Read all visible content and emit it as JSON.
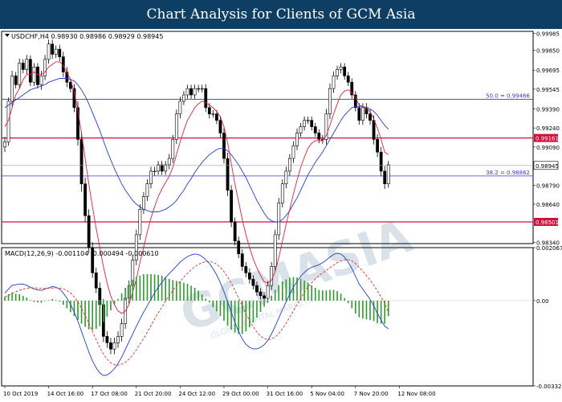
{
  "banner": {
    "title": "Chart Analysis for Clients of GCM Asia"
  },
  "watermark": {
    "text": "GCMASIA",
    "subtext": "GLOBAL CAPITAL MARKETS"
  },
  "chart_data": [
    {
      "type": "candlestick",
      "header": "USDCHF,H4  0.98930 0.98986 0.98929 0.98945",
      "ylim": [
        0.9833,
        1.0
      ],
      "y_ticks": [
        "0.99985",
        "0.99850",
        "0.99695",
        "0.99545",
        "0.99390",
        "0.99240",
        "0.99090",
        "0.98945",
        "0.98790",
        "0.98640",
        "0.98490",
        "0.98340"
      ],
      "y_tick_values": [
        0.99985,
        0.9985,
        0.99695,
        0.99545,
        0.9939,
        0.9924,
        0.9909,
        0.98945,
        0.9879,
        0.9864,
        0.9849,
        0.9834
      ],
      "x_ticks": [
        "10 Oct 2019",
        "14 Oct 16:00",
        "17 Oct 08:00",
        "21 Oct 20:00",
        "24 Oct 12:00",
        "29 Oct 00:00",
        "31 Oct 16:00",
        "5 Nov 04:00",
        "7 Nov 20:00",
        "12 Nov 08:00"
      ],
      "x_tick_index": [
        0,
        12,
        24,
        36,
        48,
        60,
        72,
        84,
        96,
        108
      ],
      "num_bars": 120,
      "current_price": {
        "label": "0.98945",
        "value": 0.98945
      },
      "levels": [
        {
          "kind": "fib",
          "label": "50.0 = 0.99466",
          "value": 0.99466,
          "color": "#3a3ac8"
        },
        {
          "kind": "fib",
          "label": "38.2 = 0.98862",
          "value": 0.98862,
          "color": "#3a3ac8"
        },
        {
          "kind": "sr",
          "label": "0.99161",
          "value": 0.99161,
          "color": "#d0103a"
        },
        {
          "kind": "sr",
          "label": "0.98501",
          "value": 0.98501,
          "color": "#d0103a"
        }
      ],
      "closes": [
        0.9913,
        0.9945,
        0.9965,
        0.9958,
        0.9975,
        0.997,
        0.9978,
        0.996,
        0.9972,
        0.9958,
        0.9965,
        0.9978,
        0.999,
        0.9982,
        0.9986,
        0.998,
        0.9968,
        0.996,
        0.9955,
        0.994,
        0.9915,
        0.988,
        0.9855,
        0.983,
        0.981,
        0.9798,
        0.9785,
        0.976,
        0.9755,
        0.975,
        0.9755,
        0.976,
        0.977,
        0.979,
        0.98,
        0.982,
        0.984,
        0.986,
        0.987,
        0.988,
        0.989,
        0.989,
        0.9895,
        0.989,
        0.9895,
        0.99,
        0.9915,
        0.9935,
        0.9945,
        0.995,
        0.9955,
        0.995,
        0.9955,
        0.9955,
        0.9955,
        0.994,
        0.9935,
        0.9935,
        0.993,
        0.992,
        0.99,
        0.9875,
        0.985,
        0.9835,
        0.9825,
        0.9815,
        0.981,
        0.9805,
        0.98,
        0.9795,
        0.9792,
        0.979,
        0.98,
        0.9815,
        0.984,
        0.9865,
        0.988,
        0.989,
        0.99,
        0.991,
        0.992,
        0.9925,
        0.993,
        0.993,
        0.9925,
        0.992,
        0.9915,
        0.9915,
        0.9935,
        0.9955,
        0.9965,
        0.997,
        0.9972,
        0.9965,
        0.996,
        0.995,
        0.994,
        0.993,
        0.994,
        0.9935,
        0.993,
        0.9915,
        0.9905,
        0.989,
        0.988,
        0.9895
      ],
      "volatility": [
        0.0008,
        0.0006,
        0.0008,
        0.0006,
        0.0007,
        0.0006,
        0.0007,
        0.0006,
        0.0006,
        0.0006,
        0.0008,
        0.0007,
        0.0007,
        0.0007,
        0.0006,
        0.0007,
        0.0008,
        0.0008,
        0.0006,
        0.0007,
        0.001,
        0.0012,
        0.001,
        0.001,
        0.0008,
        0.0008,
        0.0009,
        0.0009,
        0.0008,
        0.0008,
        0.0008,
        0.0008,
        0.0008,
        0.0008,
        0.0008,
        0.0009,
        0.0008,
        0.0008,
        0.0007,
        0.0007,
        0.0007,
        0.0007,
        0.0006,
        0.0006,
        0.0006,
        0.0007,
        0.0007,
        0.0007,
        0.0007,
        0.0006,
        0.0006,
        0.0006,
        0.0006,
        0.0006,
        0.0006,
        0.0007,
        0.0007,
        0.0006,
        0.0006,
        0.0007,
        0.0008,
        0.0009,
        0.0008,
        0.0007,
        0.0007,
        0.0007,
        0.0007,
        0.0007,
        0.0006,
        0.0006,
        0.0006,
        0.0006,
        0.0007,
        0.0007,
        0.0008,
        0.0008,
        0.0007,
        0.0007,
        0.0007,
        0.0007,
        0.0007,
        0.0006,
        0.0006,
        0.0006,
        0.0006,
        0.0006,
        0.0006,
        0.0007,
        0.0008,
        0.0008,
        0.0007,
        0.0006,
        0.0006,
        0.0006,
        0.0006,
        0.0006,
        0.0006,
        0.0007,
        0.0007,
        0.0007,
        0.0007,
        0.0008,
        0.0008,
        0.0008,
        0.0008,
        0.0006
      ],
      "ma_fast": [
        0.9925,
        0.993,
        0.994,
        0.995,
        0.9955,
        0.9962,
        0.9966,
        0.9966,
        0.9968,
        0.9966,
        0.9966,
        0.9968,
        0.9972,
        0.9974,
        0.9976,
        0.9976,
        0.9973,
        0.9968,
        0.9962,
        0.9952,
        0.9938,
        0.992,
        0.99,
        0.988,
        0.9862,
        0.9845,
        0.983,
        0.9815,
        0.9802,
        0.9792,
        0.9785,
        0.978,
        0.9778,
        0.978,
        0.9785,
        0.9795,
        0.9805,
        0.9818,
        0.983,
        0.9842,
        0.9853,
        0.9862,
        0.987,
        0.9876,
        0.9881,
        0.9886,
        0.9893,
        0.9903,
        0.9913,
        0.9922,
        0.993,
        0.9935,
        0.994,
        0.9943,
        0.9945,
        0.9944,
        0.9942,
        0.994,
        0.9937,
        0.9933,
        0.9925,
        0.9912,
        0.9896,
        0.988,
        0.9866,
        0.9852,
        0.984,
        0.983,
        0.9821,
        0.9814,
        0.9808,
        0.9803,
        0.9802,
        0.9804,
        0.9811,
        0.9822,
        0.9835,
        0.9848,
        0.986,
        0.9872,
        0.9883,
        0.9893,
        0.9901,
        0.9908,
        0.9912,
        0.9914,
        0.9914,
        0.9914,
        0.9918,
        0.9926,
        0.9935,
        0.9943,
        0.995,
        0.9953,
        0.9954,
        0.9952,
        0.9948,
        0.9942,
        0.9941,
        0.9939,
        0.9937,
        0.9931,
        0.9924,
        0.9915,
        0.9905,
        0.9903
      ],
      "ma_slow": [
        0.994,
        0.9942,
        0.9944,
        0.9946,
        0.9948,
        0.995,
        0.9952,
        0.9954,
        0.9955,
        0.9956,
        0.9957,
        0.9958,
        0.996,
        0.9961,
        0.9962,
        0.9963,
        0.9963,
        0.9963,
        0.9962,
        0.9961,
        0.9958,
        0.9954,
        0.9949,
        0.9943,
        0.9936,
        0.9929,
        0.9922,
        0.9914,
        0.9906,
        0.9899,
        0.9892,
        0.9886,
        0.988,
        0.9875,
        0.9871,
        0.9867,
        0.9864,
        0.9862,
        0.986,
        0.9859,
        0.9858,
        0.9858,
        0.9858,
        0.9859,
        0.986,
        0.9862,
        0.9864,
        0.9867,
        0.9871,
        0.9875,
        0.988,
        0.9884,
        0.9889,
        0.9893,
        0.9897,
        0.99,
        0.9903,
        0.9905,
        0.9907,
        0.9908,
        0.9908,
        0.9906,
        0.9903,
        0.9899,
        0.9895,
        0.989,
        0.9885,
        0.9879,
        0.9873,
        0.9867,
        0.9862,
        0.9857,
        0.9853,
        0.9851,
        0.985,
        0.985,
        0.9852,
        0.9855,
        0.9859,
        0.9864,
        0.9869,
        0.9875,
        0.9881,
        0.9887,
        0.9892,
        0.9897,
        0.9901,
        0.9905,
        0.991,
        0.9915,
        0.992,
        0.9925,
        0.993,
        0.9934,
        0.9937,
        0.994,
        0.9941,
        0.9941,
        0.9941,
        0.994,
        0.9939,
        0.9937,
        0.9934,
        0.993,
        0.9926,
        0.9923
      ]
    },
    {
      "type": "macd",
      "header": "MACD(12,26,9) -0.001104 -0.000494 -0.000610",
      "ylim": [
        -0.003325,
        0.002067
      ],
      "y_ticks": [
        "0.002067",
        "0.00",
        "-0.003325"
      ],
      "y_tick_values": [
        0.002067,
        0.0,
        -0.003325
      ],
      "histogram_color": "#2e9a2e",
      "macd_color": "#2040d0",
      "signal_color": "#e03030",
      "macd": [
        0.0003,
        0.00045,
        0.0006,
        0.00062,
        0.00065,
        0.00064,
        0.0006,
        0.00052,
        0.00045,
        0.00042,
        0.0004,
        0.00045,
        0.0005,
        0.00055,
        0.00052,
        0.00045,
        0.0003,
        0.0001,
        -0.00015,
        -0.00045,
        -0.0008,
        -0.0012,
        -0.0016,
        -0.002,
        -0.00235,
        -0.00262,
        -0.00282,
        -0.00292,
        -0.0029,
        -0.0028,
        -0.00265,
        -0.00245,
        -0.0022,
        -0.0019,
        -0.0016,
        -0.0013,
        -0.001,
        -0.00072,
        -0.00045,
        -0.0002,
        5e-05,
        0.0003,
        0.00052,
        0.00072,
        0.0009,
        0.00105,
        0.0012,
        0.00135,
        0.0015,
        0.00162,
        0.00172,
        0.00178,
        0.00182,
        0.0018,
        0.00172,
        0.0016,
        0.00145,
        0.00125,
        0.001,
        0.0007,
        0.00035,
        -5e-05,
        -0.00045,
        -0.00085,
        -0.0012,
        -0.0015,
        -0.0017,
        -0.00182,
        -0.00188,
        -0.00188,
        -0.00182,
        -0.00172,
        -0.00155,
        -0.0013,
        -0.001,
        -0.00068,
        -0.00035,
        -5e-05,
        0.00025,
        0.00052,
        0.00075,
        0.00095,
        0.0011,
        0.00122,
        0.0013,
        0.00135,
        0.0014,
        0.00148,
        0.00158,
        0.0017,
        0.0018,
        0.00185,
        0.00182,
        0.0017,
        0.0015,
        0.00125,
        0.00095,
        0.00065,
        0.00045,
        0.00025,
        5e-05,
        -0.0002,
        -0.0005,
        -0.00075,
        -0.001,
        -0.0011
      ],
      "signal": [
        0.00015,
        0.0002,
        0.00028,
        0.00035,
        0.0004,
        0.00045,
        0.00048,
        0.0005,
        0.0005,
        0.00049,
        0.00048,
        0.00047,
        0.00048,
        0.00049,
        0.0005,
        0.00049,
        0.00046,
        0.0004,
        0.0003,
        0.00015,
        -5e-05,
        -0.0003,
        -0.00058,
        -0.00088,
        -0.0012,
        -0.00152,
        -0.00182,
        -0.00208,
        -0.00228,
        -0.00242,
        -0.0025,
        -0.00252,
        -0.00248,
        -0.0024,
        -0.00228,
        -0.00212,
        -0.00192,
        -0.0017,
        -0.00148,
        -0.00124,
        -0.00098,
        -0.00072,
        -0.00048,
        -0.00025,
        -2e-05,
        0.0002,
        0.0004,
        0.00058,
        0.00075,
        0.00092,
        0.00106,
        0.0012,
        0.00132,
        0.00141,
        0.00148,
        0.00152,
        0.00152,
        0.0015,
        0.00142,
        0.0013,
        0.00113,
        0.00092,
        0.00068,
        0.0004,
        0.0001,
        -0.0002,
        -0.0005,
        -0.00078,
        -0.00102,
        -0.00122,
        -0.00138,
        -0.00148,
        -0.00152,
        -0.0015,
        -0.00142,
        -0.00128,
        -0.0011,
        -0.00088,
        -0.00065,
        -0.0004,
        -0.00015,
        0.0001,
        0.00032,
        0.00052,
        0.0007,
        0.00085,
        0.00098,
        0.00108,
        0.00118,
        0.00128,
        0.00138,
        0.00148,
        0.00155,
        0.0016,
        0.0016,
        0.00155,
        0.00145,
        0.0013,
        0.00115,
        0.00098,
        0.0008,
        0.0006,
        0.00038,
        0.00015,
        -0.0001,
        -0.00049
      ]
    }
  ]
}
